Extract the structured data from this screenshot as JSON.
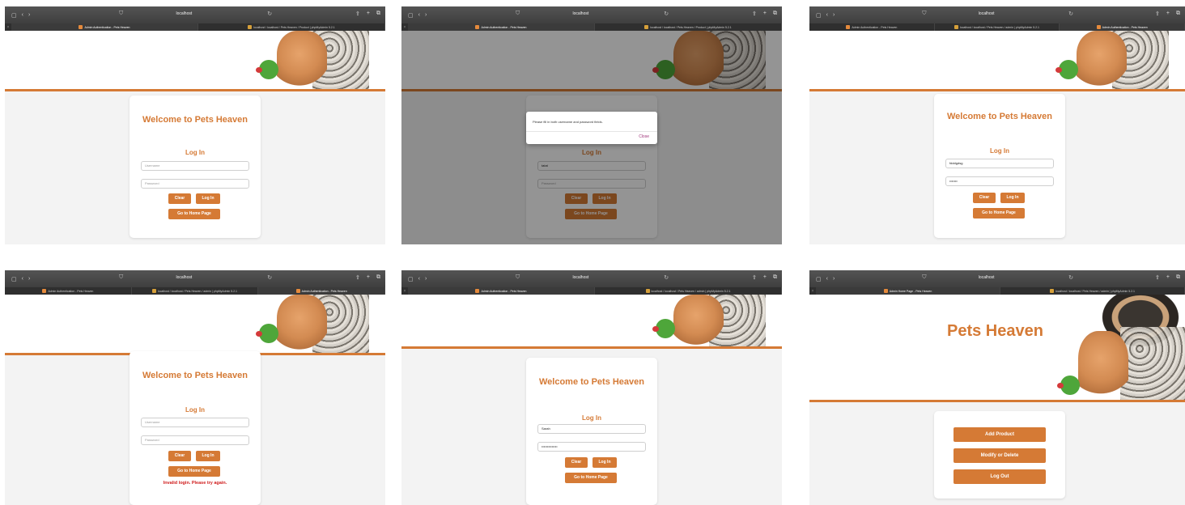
{
  "browser": {
    "address": "localhost",
    "tab_login": "Admin Authentication - Pets Heaven",
    "tab_pma_products": "localhost / localhost / Pets Heaven / Product | phpMyAdmin 5.2.1",
    "tab_pma_admin": "localhost / localhost / Pets Heaven / admin | phpMyAdmin 5.2.1",
    "tab_home": "Admin Home Page - Pets Heaven"
  },
  "login": {
    "welcome": "Welcome to Pets Heaven",
    "title": "Log In",
    "username_placeholder": "Username",
    "password_placeholder": "Password",
    "clear": "Clear",
    "login": "Log In",
    "home": "Go to Home Page"
  },
  "frames": {
    "f2_username": "tatat",
    "f3_username": "fdddgdsg",
    "f3_password": "•••••••",
    "f5_username": "Sarah",
    "f5_password": "••••••••••••••"
  },
  "dialog": {
    "message": "Please fill in both username and password fields.",
    "close": "Close"
  },
  "error": "Invalid login. Please try again.",
  "home": {
    "title": "Pets Heaven",
    "add": "Add Product",
    "modify": "Modify or Delete",
    "logout": "Log Out"
  },
  "colors": {
    "accent": "#d57a35",
    "error": "#d01e1e"
  }
}
